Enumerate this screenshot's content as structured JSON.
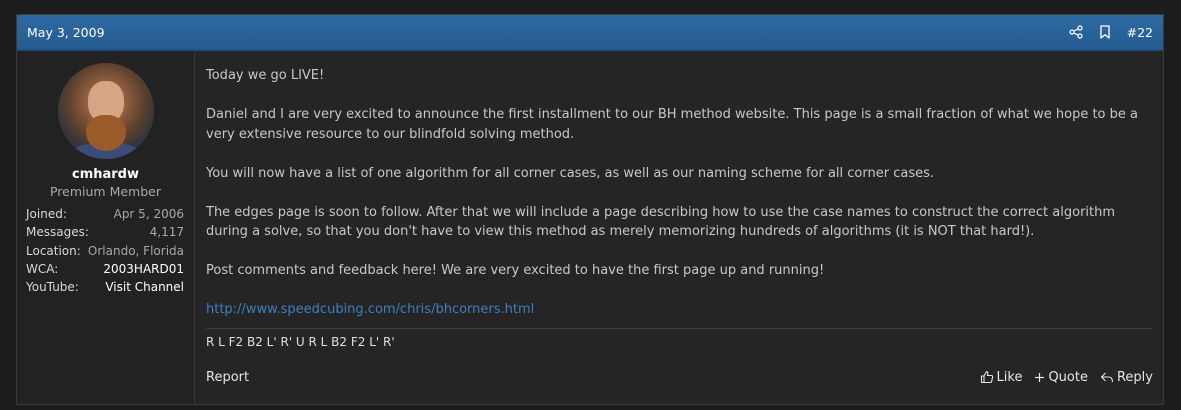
{
  "post": {
    "date": "May 3, 2009",
    "number": "#22",
    "header_icons": [
      "share-icon",
      "bookmark-icon"
    ]
  },
  "user": {
    "name": "cmhardw",
    "title": "Premium Member",
    "stats": [
      {
        "label": "Joined:",
        "value": "Apr 5, 2006"
      },
      {
        "label": "Messages:",
        "value": "4,117"
      },
      {
        "label": "Location:",
        "value": "Orlando, Florida"
      },
      {
        "label": "WCA:",
        "value": "2003HARD01"
      },
      {
        "label": "YouTube:",
        "value": "Visit Channel"
      }
    ]
  },
  "message": {
    "p1": "Today we go LIVE!",
    "p2": "Daniel and I are very excited to announce the first installment to our BH method website. This page is a small fraction of what we hope to be a very extensive resource to our blindfold solving method.",
    "p3": "You will now have a list of one algorithm for all corner cases, as well as our naming scheme for all corner cases.",
    "p4": "The edges page is soon to follow. After that we will include a page describing how to use the case names to construct the correct algorithm during a solve, so that you don't have to view this method as merely memorizing hundreds of algorithms (it is NOT that hard!).",
    "p5": "Post comments and feedback here! We are very excited to have the first page up and running!",
    "link": "http://www.speedcubing.com/chris/bhcorners.html"
  },
  "signature": "R L F2 B2 L' R' U R L B2 F2 L' R'",
  "actions": {
    "report": "Report",
    "like": "Like",
    "quote": "Quote",
    "reply": "Reply"
  },
  "colors": {
    "header": "#2e6aa2",
    "link": "#3e7ec0",
    "background": "#252525"
  }
}
